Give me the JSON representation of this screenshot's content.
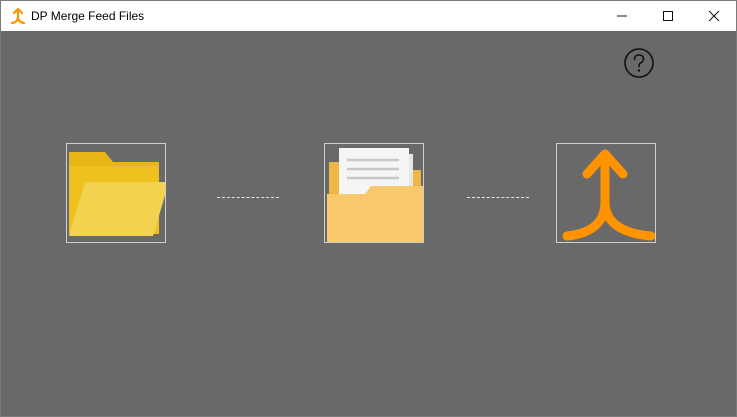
{
  "window": {
    "title": "DP Merge Feed Files",
    "app_icon": "merge-arrow-icon",
    "controls": {
      "minimize_icon": "minimize-icon",
      "maximize_icon": "maximize-icon",
      "close_icon": "close-icon"
    }
  },
  "main": {
    "help_icon": "question-circle-icon",
    "steps": [
      {
        "icon": "folder-open-icon"
      },
      {
        "icon": "folder-with-documents-icon"
      },
      {
        "icon": "merge-arrow-icon"
      }
    ]
  },
  "colors": {
    "background": "#696969",
    "accent_orange": "#FF9400",
    "folder_yellow": "#F0C419",
    "folder_light": "#F7C96A"
  }
}
